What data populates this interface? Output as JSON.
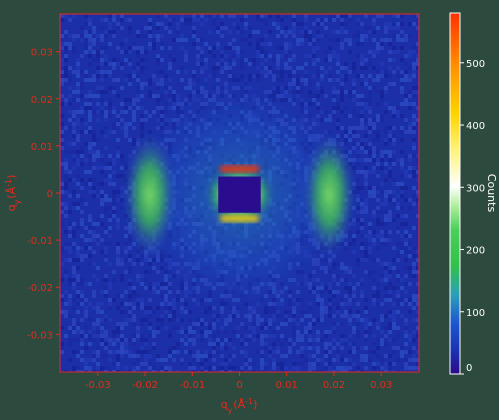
{
  "chart_data": {
    "type": "heatmap",
    "xlabel": "q",
    "xlabel_sub": "y",
    "xlabel_unit": "(Å",
    "xlabel_unit_sup": "-1",
    "xlabel_unit_end": ")",
    "ylabel": "q",
    "ylabel_sub": "y",
    "ylabel_unit": "(Å",
    "ylabel_unit_sup": "-1",
    "ylabel_unit_end": ")",
    "xlim": [
      -0.038,
      0.038
    ],
    "ylim": [
      -0.038,
      0.038
    ],
    "x_ticks": [
      -0.03,
      -0.02,
      -0.01,
      0,
      0.01,
      0.02,
      0.03
    ],
    "x_tick_labels": [
      "-0.03",
      "-0.02",
      "-0.01",
      "0",
      "0.01",
      "0.02",
      "0.03"
    ],
    "y_ticks": [
      0.03,
      0.02,
      0.01,
      0,
      -0.01,
      -0.02,
      -0.03
    ],
    "y_tick_labels": [
      "0.03",
      "0.02",
      "0.01",
      "0",
      "-0.01",
      "-0.02",
      "-0.03"
    ],
    "colorbar": {
      "label": "Counts",
      "range": [
        0,
        580
      ],
      "ticks": [
        0,
        100,
        200,
        300,
        400,
        500
      ],
      "tick_labels": [
        "0",
        "100",
        "200",
        "300",
        "400",
        "500"
      ]
    },
    "beamstop": {
      "qx": [
        -0.0045,
        0.0045
      ],
      "qy": [
        -0.0042,
        0.0035
      ]
    },
    "features": [
      {
        "name": "left-arc",
        "qx": -0.019,
        "peak_counts": 240
      },
      {
        "name": "right-arc",
        "qx": 0.019,
        "peak_counts": 240
      },
      {
        "name": "top-edge",
        "qy": 0.0045,
        "peak_counts": 580
      },
      {
        "name": "bottom-edge",
        "qy": -0.005,
        "peak_counts": 500
      }
    ],
    "colors": {
      "axis_color": "#e8281e",
      "colormap": [
        "#2c0a8c",
        "#1a2fb0",
        "#1c55d0",
        "#2aa0b8",
        "#31c14a",
        "#7ee060",
        "#ffffff",
        "#ffd400",
        "#ff8c00",
        "#ff3000"
      ]
    }
  }
}
